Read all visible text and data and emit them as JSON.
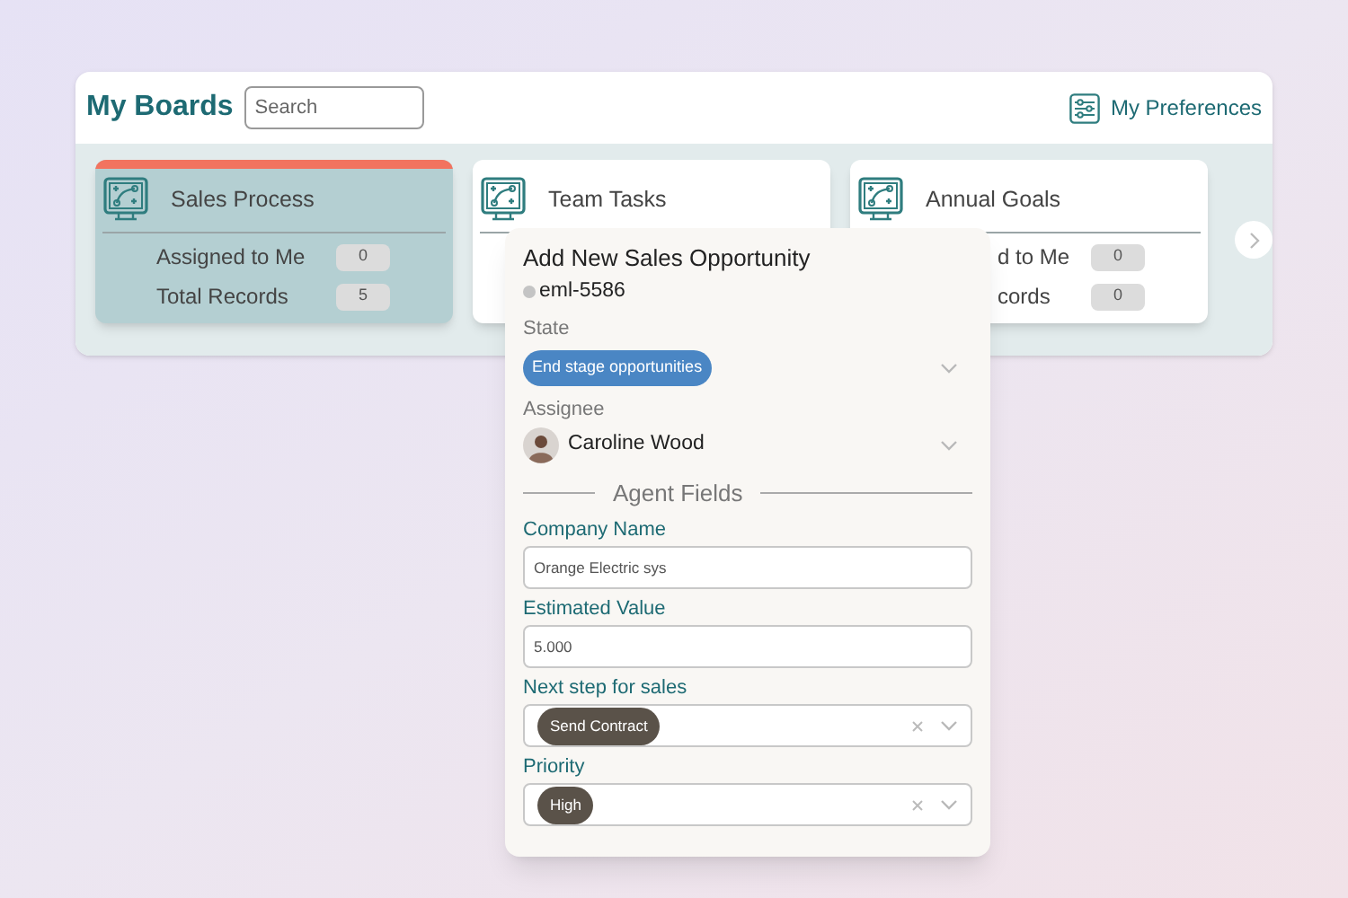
{
  "header": {
    "title": "My Boards",
    "search": {
      "placeholder": "Search"
    },
    "preferences": "My Preferences"
  },
  "boards": [
    {
      "title": "Sales Process",
      "selected": true,
      "stats": [
        {
          "label": "Assigned to Me",
          "value": "0"
        },
        {
          "label": "Total Records",
          "value": "5"
        }
      ]
    },
    {
      "title": "Team Tasks",
      "selected": false
    },
    {
      "title": "Annual Goals",
      "selected": false,
      "stats": [
        {
          "label": "d to Me",
          "value": "0"
        },
        {
          "label": "cords",
          "value": "0"
        }
      ]
    }
  ],
  "dialog": {
    "title": "Add New Sales Opportunity",
    "id": "eml-5586",
    "state_label": "State",
    "state": "End stage opportunities",
    "assignee_label": "Assignee",
    "assignee": "Caroline Wood",
    "section": "Agent Fields",
    "fields": [
      {
        "kind": "text",
        "label": "Company Name",
        "value": "Orange Electric sys"
      },
      {
        "kind": "text",
        "label": "Estimated Value",
        "value": "5.000"
      },
      {
        "kind": "select",
        "label": "Next step for sales",
        "value": "Send Contract"
      },
      {
        "kind": "select",
        "label": "Priority",
        "value": "High"
      }
    ]
  }
}
